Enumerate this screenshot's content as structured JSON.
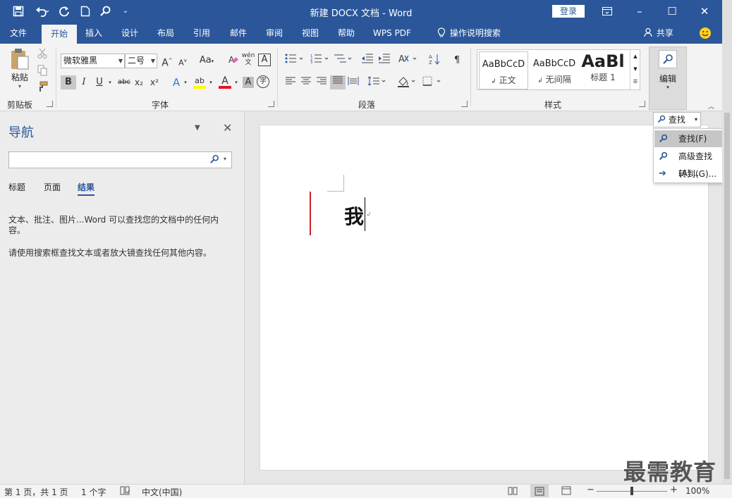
{
  "window": {
    "title": "新建 DOCX 文档  -  Word",
    "login": "登录",
    "minimize": "–",
    "maximize": "☐",
    "close": "✕",
    "ribbon_display": "⊡"
  },
  "quick_access": {
    "save": "💾",
    "undo": "↶",
    "redo": "↻",
    "new_doc": "🗋",
    "find": "⚲",
    "customize": "⌄"
  },
  "tabs": [
    "文件",
    "开始",
    "插入",
    "设计",
    "布局",
    "引用",
    "邮件",
    "审阅",
    "视图",
    "帮助",
    "WPS PDF"
  ],
  "active_tab": "开始",
  "tell_me": "操作说明搜索",
  "share": "共享",
  "clipboard": {
    "paste": "粘贴",
    "group_label": "剪贴板"
  },
  "font": {
    "font_name": "微软雅黑",
    "font_size": "二号",
    "group_label": "字体",
    "bold": "B",
    "italic": "I",
    "underline": "U",
    "strike": "abc",
    "subscript": "x₂",
    "superscript": "x²",
    "grow": "A",
    "shrink": "A",
    "change_case": "Aa",
    "clear": "A",
    "phonetic": "wén",
    "char_border": "A",
    "text_effect": "A",
    "highlight": "ab",
    "font_color": "A",
    "char_shading": "A",
    "enclose": "字"
  },
  "paragraph": {
    "group_label": "段落"
  },
  "styles": {
    "group_label": "样式",
    "items": [
      {
        "preview": "AaBbCcD",
        "name": "正文"
      },
      {
        "preview": "AaBbCcD",
        "name": "无间隔"
      },
      {
        "preview": "AaBl",
        "name": "标题 1"
      }
    ]
  },
  "editing": {
    "label": "编辑",
    "find_split": "查找",
    "menu": [
      {
        "label": "查找(F)",
        "icon": "search-icon"
      },
      {
        "label": "高级查找(A)...",
        "icon": "search-icon"
      },
      {
        "label": "转到(G)...",
        "icon": "arrow-right-icon"
      }
    ]
  },
  "nav_pane": {
    "title": "导航",
    "search_placeholder": "",
    "tabs": [
      "标题",
      "页面",
      "结果"
    ],
    "active_tab": "结果",
    "hint1": "文本、批注、图片...Word 可以查找您的文档中的任何内容。",
    "hint2": "请使用搜索框查找文本或者放大镜查找任何其他内容。"
  },
  "document": {
    "text": "我"
  },
  "status": {
    "page": "第 1 页，共 1 页",
    "words": "1 个字",
    "language": "中文(中国)",
    "zoom": "100%",
    "zoom_minus": "−",
    "zoom_plus": "+"
  },
  "watermark": "最需教育",
  "colors": {
    "accent": "#2b579a",
    "highlight": "#ffff00",
    "font_color": "#e81123",
    "change_bar": "#c8202a"
  }
}
